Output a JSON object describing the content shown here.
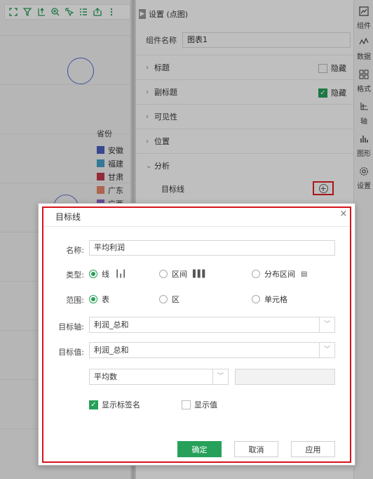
{
  "toolbar": {
    "icons": [
      "fullscreen-icon",
      "filter-icon",
      "drill-icon",
      "zoom-in-icon",
      "select-icon",
      "list-icon",
      "export-icon",
      "more-icon"
    ]
  },
  "legend": {
    "title": "省份",
    "items": [
      {
        "label": "安徽",
        "color": "#4a5fc1"
      },
      {
        "label": "福建",
        "color": "#45a0c8"
      },
      {
        "label": "甘肃",
        "color": "#c23b4b"
      },
      {
        "label": "广东",
        "color": "#e8866a"
      },
      {
        "label": "广西",
        "color": "#8a6bc6"
      }
    ]
  },
  "settings": {
    "header": "设置 (点图)",
    "component_name_label": "组件名称",
    "component_name_value": "图表1",
    "sections": [
      {
        "label": "标题",
        "hide_label": "隐藏",
        "hidden": false
      },
      {
        "label": "副标题",
        "hide_label": "隐藏",
        "hidden": true
      },
      {
        "label": "可见性"
      },
      {
        "label": "位置"
      },
      {
        "label": "分析"
      }
    ],
    "target_line_label": "目标线"
  },
  "iconbar": [
    {
      "label": "组件",
      "icon": "component-icon"
    },
    {
      "label": "数据",
      "icon": "data-icon"
    },
    {
      "label": "格式",
      "icon": "format-icon"
    },
    {
      "label": "轴",
      "icon": "axis-icon"
    },
    {
      "label": "图形",
      "icon": "graph-icon"
    },
    {
      "label": "设置",
      "icon": "gear-icon"
    }
  ],
  "dialog": {
    "title": "目标线",
    "close_symbol": "×",
    "name_label": "名称:",
    "name_value": "平均利润",
    "type_label": "类型:",
    "type_options": [
      {
        "label": "线",
        "selected": true,
        "icon": "bar-line-icon"
      },
      {
        "label": "区间",
        "selected": false,
        "icon": "bar-band-icon"
      },
      {
        "label": "分布区间",
        "selected": false,
        "icon": "distribution-icon"
      }
    ],
    "range_label": "范围:",
    "range_options": [
      {
        "label": "表",
        "selected": true
      },
      {
        "label": "区",
        "selected": false
      },
      {
        "label": "单元格",
        "selected": false
      }
    ],
    "target_axis_label": "目标轴:",
    "target_axis_value": "利润_总和",
    "target_value_label": "目标值:",
    "target_value_value": "利润_总和",
    "aggregation_value": "平均数",
    "show_label_text": "显示标签名",
    "show_label_checked": true,
    "show_value_text": "显示值",
    "show_value_checked": false,
    "confirm_label": "确定",
    "cancel_label": "取消",
    "apply_label": "应用"
  }
}
